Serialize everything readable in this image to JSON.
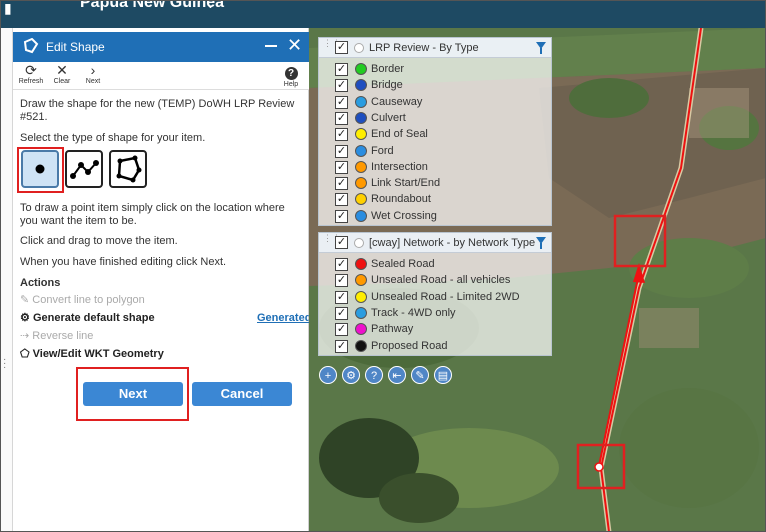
{
  "topbar": {
    "title": "Papua New Guinea"
  },
  "panel": {
    "title": "Edit Shape",
    "toolbar": {
      "refresh": "Refresh",
      "clear": "Clear",
      "next": "Next",
      "help": "Help"
    },
    "intro": "Draw the shape for the new (TEMP) DoWH LRP Review #521.",
    "select_type": "Select the type of shape for your item.",
    "shape_types": [
      "point",
      "line",
      "polygon"
    ],
    "instruction_point": "To draw a point item simply click on the location where you want the item to be.",
    "instruction_drag": "Click and drag to move the item.",
    "instruction_done": "When you have finished editing click Next.",
    "actions_title": "Actions",
    "actions": {
      "convert": "Convert line to polygon",
      "generate": "Generate default shape",
      "generated_link": "Generated",
      "reverse": "Reverse line",
      "wkt": "View/Edit WKT Geometry"
    },
    "next_button": "Next",
    "cancel_button": "Cancel"
  },
  "layers": {
    "lrp": {
      "title": "LRP Review - By Type",
      "items": [
        {
          "label": "Border",
          "color": "#22cc22"
        },
        {
          "label": "Bridge",
          "color": "#1f4fbf"
        },
        {
          "label": "Causeway",
          "color": "#2a9de0"
        },
        {
          "label": "Culvert",
          "color": "#1f4fbf"
        },
        {
          "label": "End of Seal",
          "color": "#ffee00"
        },
        {
          "label": "Ford",
          "color": "#2a8de0"
        },
        {
          "label": "Intersection",
          "color": "#ff9900"
        },
        {
          "label": "Link Start/End",
          "color": "#ff9900"
        },
        {
          "label": "Roundabout",
          "color": "#ffd000"
        },
        {
          "label": "Wet Crossing",
          "color": "#2a8de0"
        }
      ]
    },
    "network": {
      "title": "[cway] Network - by Network Type",
      "items": [
        {
          "label": "Sealed Road",
          "color": "#ee1111"
        },
        {
          "label": "Unsealed Road - all vehicles",
          "color": "#ff9900"
        },
        {
          "label": "Unsealed Road - Limited 2WD",
          "color": "#ffee00"
        },
        {
          "label": "Track - 4WD only",
          "color": "#2a9de0"
        },
        {
          "label": "Pathway",
          "color": "#ee11cc"
        },
        {
          "label": "Proposed Road",
          "color": "#111111"
        }
      ]
    }
  },
  "map_tools": [
    "zoom-in-icon",
    "settings-icon",
    "help-icon",
    "home-icon",
    "edit-icon",
    "print-icon"
  ]
}
